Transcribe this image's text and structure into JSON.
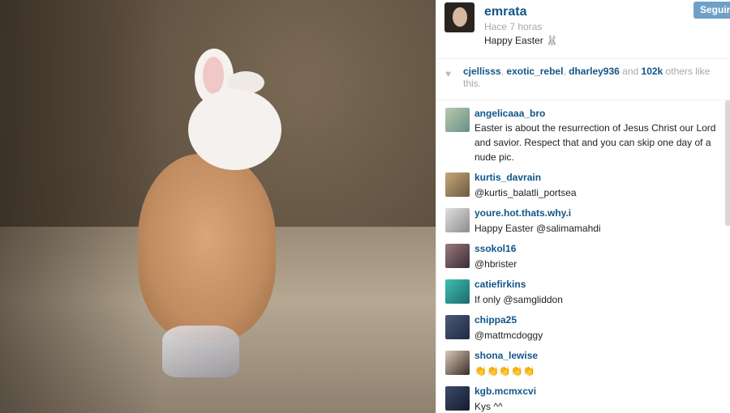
{
  "post": {
    "username": "emrata",
    "time": "Hace 7 horas",
    "caption": "Happy Easter 🐰",
    "follow_label": "Seguir"
  },
  "likes": {
    "users": [
      "cjellisss",
      "exotic_rebel",
      "dharley936"
    ],
    "sep1": ", ",
    "sep2": ", ",
    "and": " and ",
    "count": "102k",
    "suffix": " others like this."
  },
  "comments": [
    {
      "user": "angelicaaa_bro",
      "text": "Easter is about the resurrection of Jesus Christ our Lord and savior. Respect that and you can skip one day of a nude pic."
    },
    {
      "user": "kurtis_davrain",
      "text": "@kurtis_balatli_portsea"
    },
    {
      "user": "youre.hot.thats.why.i",
      "text": "Happy Easter @salimamahdi"
    },
    {
      "user": "ssokol16",
      "text": "@hbrister"
    },
    {
      "user": "catiefirkins",
      "text": "If only @samgliddon"
    },
    {
      "user": "chippa25",
      "text": "@mattmcdoggy"
    },
    {
      "user": "shona_lewise",
      "text": "👏👏👏👏👏"
    },
    {
      "user": "kgb.mcmxcvi",
      "text": "Kys ^^"
    }
  ],
  "colors": {
    "link": "#125688",
    "muted": "#a5a7aa",
    "follow_bg": "#6fa0c7"
  },
  "icons": {
    "like": "heart-icon"
  }
}
